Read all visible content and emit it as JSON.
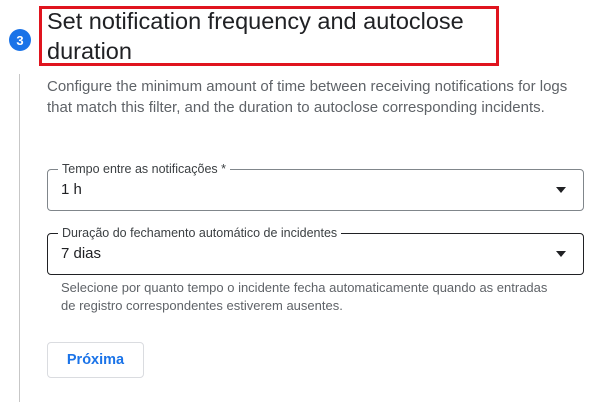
{
  "step": {
    "number": "3",
    "title": "Set notification frequency and autoclose duration",
    "description": "Configure the minimum amount of time between receiving notifications for logs that match this filter, and the duration to autoclose corresponding incidents."
  },
  "fields": {
    "notification_interval": {
      "label": "Tempo entre as notificações *",
      "value": "1 h",
      "icon": "dropdown-arrow-icon"
    },
    "autoclose_duration": {
      "label": "Duração do fechamento automático de incidentes",
      "value": "7 dias",
      "icon": "dropdown-arrow-icon",
      "hint": "Selecione por quanto tempo o incidente fecha automaticamente quando as entradas de registro correspondentes estiverem ausentes."
    }
  },
  "actions": {
    "next_label": "Próxima"
  },
  "colors": {
    "accent": "#1a73e8",
    "highlight_border": "#e0141e",
    "text_primary": "#202124",
    "text_secondary": "#5f6368"
  }
}
